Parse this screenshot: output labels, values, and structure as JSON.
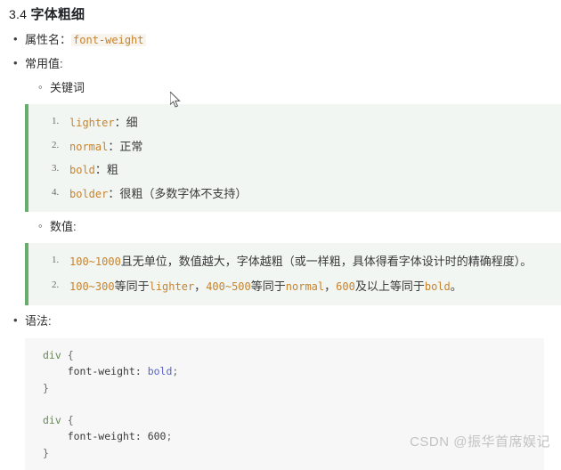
{
  "heading": {
    "number": "3.4",
    "title": "字体粗细"
  },
  "bullets": {
    "prop_name_label": "属性名：",
    "prop_name_code": "font-weight",
    "common_values_label": "常用值:",
    "syntax_label": "语法:"
  },
  "sub_bullets": {
    "keywords_label": "关键词",
    "numeric_label": "数值:"
  },
  "keywords_block": [
    {
      "code": "lighter",
      "sep": "：",
      "desc": "细"
    },
    {
      "code": "normal",
      "sep": "：",
      "desc": "正常"
    },
    {
      "code": "bold",
      "sep": "：",
      "desc": "粗"
    },
    {
      "code": "bolder",
      "sep": "：",
      "desc": "很粗（多数字体不支持）"
    }
  ],
  "numeric_block": {
    "item1": {
      "range": "100~1000",
      "text": "且无单位，数值越大，字体越粗（或一样粗，具体得看字体设计时的精确程度）。"
    },
    "item2": {
      "r1": "100~300",
      "t1": "等同于",
      "c1": "lighter",
      "t2": "，",
      "r2": "400~500",
      "t3": "等同于",
      "c2": "normal",
      "t4": "，",
      "r3": "600",
      "t5": "及以上等同于",
      "c3": "bold",
      "t6": "。"
    }
  },
  "code_blocks": [
    {
      "selector": "div",
      "open": " {",
      "property": "    font-weight: ",
      "value": "bold",
      "semi": ";",
      "close": "}"
    },
    {
      "selector": "div",
      "open": " {",
      "property": "    font-weight: ",
      "value": "600",
      "semi": ";",
      "close": "}"
    }
  ],
  "watermark": "CSDN @振华首席娱记",
  "colors": {
    "accent_green": "#67ae6c",
    "quote_bg": "#f1f6f3",
    "inline_code": "#c7832e",
    "code_bg": "#f7f7f7",
    "code_value": "#5b63c9",
    "code_selector": "#6a8759",
    "watermark": "#c3c3c3"
  }
}
